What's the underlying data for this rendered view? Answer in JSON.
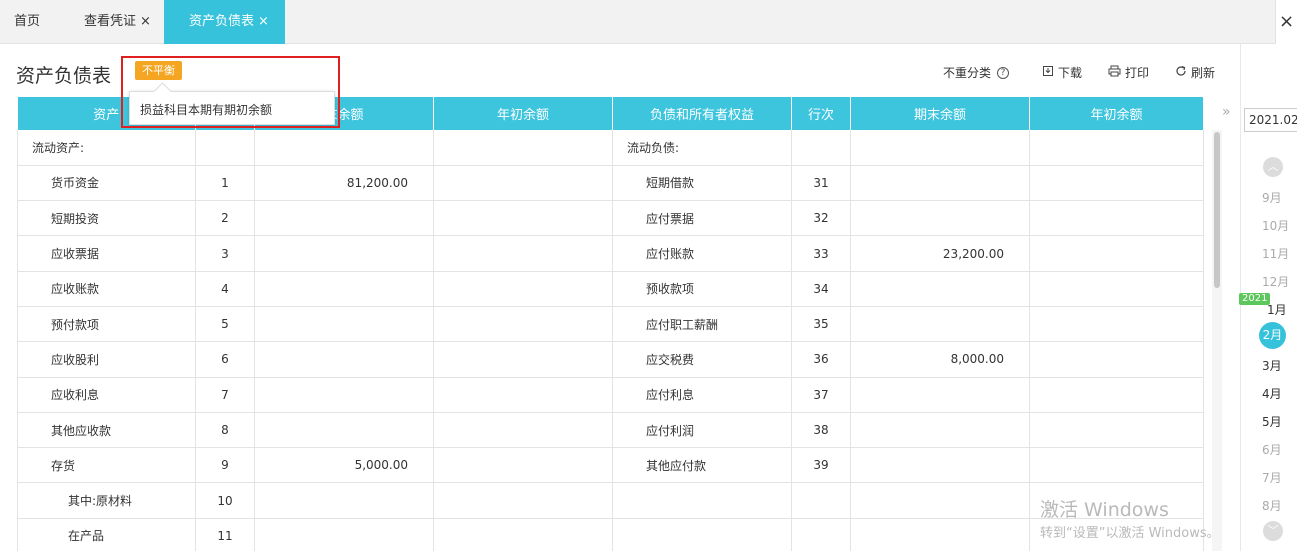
{
  "tabs": [
    {
      "label": "首页"
    },
    {
      "label": "查看凭证",
      "close": "×"
    },
    {
      "label": "资产负债表",
      "close": "×"
    }
  ],
  "window_close": "×",
  "page_title": "资产负债表",
  "status_badge": "不平衡",
  "popup_message": "损益科目本期有期初余额",
  "toolbar": {
    "no_classify": "不重分类",
    "help": "?",
    "download": "下载",
    "print": "打印",
    "refresh": "刷新"
  },
  "table": {
    "headers": [
      "资产",
      "",
      "末余额",
      "年初余额",
      "负债和所有者权益",
      "行次",
      "期末余额",
      "年初余额"
    ],
    "rows": [
      {
        "asset": "流动资产:",
        "a_line": "",
        "a_end": "",
        "a_begin": "",
        "liab": "流动负债:",
        "l_line": "",
        "l_end": "",
        "l_begin": "",
        "a_level": 0,
        "l_level": 0
      },
      {
        "asset": "货币资金",
        "a_line": "1",
        "a_end": "81,200.00",
        "a_begin": "",
        "liab": "短期借款",
        "l_line": "31",
        "l_end": "",
        "l_begin": "",
        "a_level": 1,
        "l_level": 1
      },
      {
        "asset": "短期投资",
        "a_line": "2",
        "a_end": "",
        "a_begin": "",
        "liab": "应付票据",
        "l_line": "32",
        "l_end": "",
        "l_begin": "",
        "a_level": 1,
        "l_level": 1
      },
      {
        "asset": "应收票据",
        "a_line": "3",
        "a_end": "",
        "a_begin": "",
        "liab": "应付账款",
        "l_line": "33",
        "l_end": "23,200.00",
        "l_begin": "",
        "a_level": 1,
        "l_level": 1
      },
      {
        "asset": "应收账款",
        "a_line": "4",
        "a_end": "",
        "a_begin": "",
        "liab": "预收款项",
        "l_line": "34",
        "l_end": "",
        "l_begin": "",
        "a_level": 1,
        "l_level": 1
      },
      {
        "asset": "预付款项",
        "a_line": "5",
        "a_end": "",
        "a_begin": "",
        "liab": "应付职工薪酬",
        "l_line": "35",
        "l_end": "",
        "l_begin": "",
        "a_level": 1,
        "l_level": 1
      },
      {
        "asset": "应收股利",
        "a_line": "6",
        "a_end": "",
        "a_begin": "",
        "liab": "应交税费",
        "l_line": "36",
        "l_end": "8,000.00",
        "l_begin": "",
        "a_level": 1,
        "l_level": 1
      },
      {
        "asset": "应收利息",
        "a_line": "7",
        "a_end": "",
        "a_begin": "",
        "liab": "应付利息",
        "l_line": "37",
        "l_end": "",
        "l_begin": "",
        "a_level": 1,
        "l_level": 1
      },
      {
        "asset": "其他应收款",
        "a_line": "8",
        "a_end": "",
        "a_begin": "",
        "liab": "应付利润",
        "l_line": "38",
        "l_end": "",
        "l_begin": "",
        "a_level": 1,
        "l_level": 1
      },
      {
        "asset": "存货",
        "a_line": "9",
        "a_end": "5,000.00",
        "a_begin": "",
        "liab": "其他应付款",
        "l_line": "39",
        "l_end": "",
        "l_begin": "",
        "a_level": 1,
        "l_level": 1
      },
      {
        "asset": "其中:原材料",
        "a_line": "10",
        "a_end": "",
        "a_begin": "",
        "liab": "",
        "l_line": "",
        "l_end": "",
        "l_begin": "",
        "a_level": 2,
        "l_level": 1
      },
      {
        "asset": "在产品",
        "a_line": "11",
        "a_end": "",
        "a_begin": "",
        "liab": "",
        "l_line": "",
        "l_end": "",
        "l_begin": "",
        "a_level": 2,
        "l_level": 1
      }
    ]
  },
  "date_input": "2021.02",
  "year_tag": "2021",
  "months": {
    "m9": "9月",
    "m10": "10月",
    "m11": "11月",
    "m12": "12月",
    "m1": "1月",
    "m2": "2月",
    "m3": "3月",
    "m4": "4月",
    "m5": "5月",
    "m6": "6月",
    "m7": "7月",
    "m8": "8月"
  },
  "watermark": {
    "line1": "激活 Windows",
    "line2": "转到“设置”以激活 Windows。"
  },
  "colors": {
    "accent": "#36c2da",
    "badge": "#f4a623",
    "alert_border": "#e02020"
  }
}
